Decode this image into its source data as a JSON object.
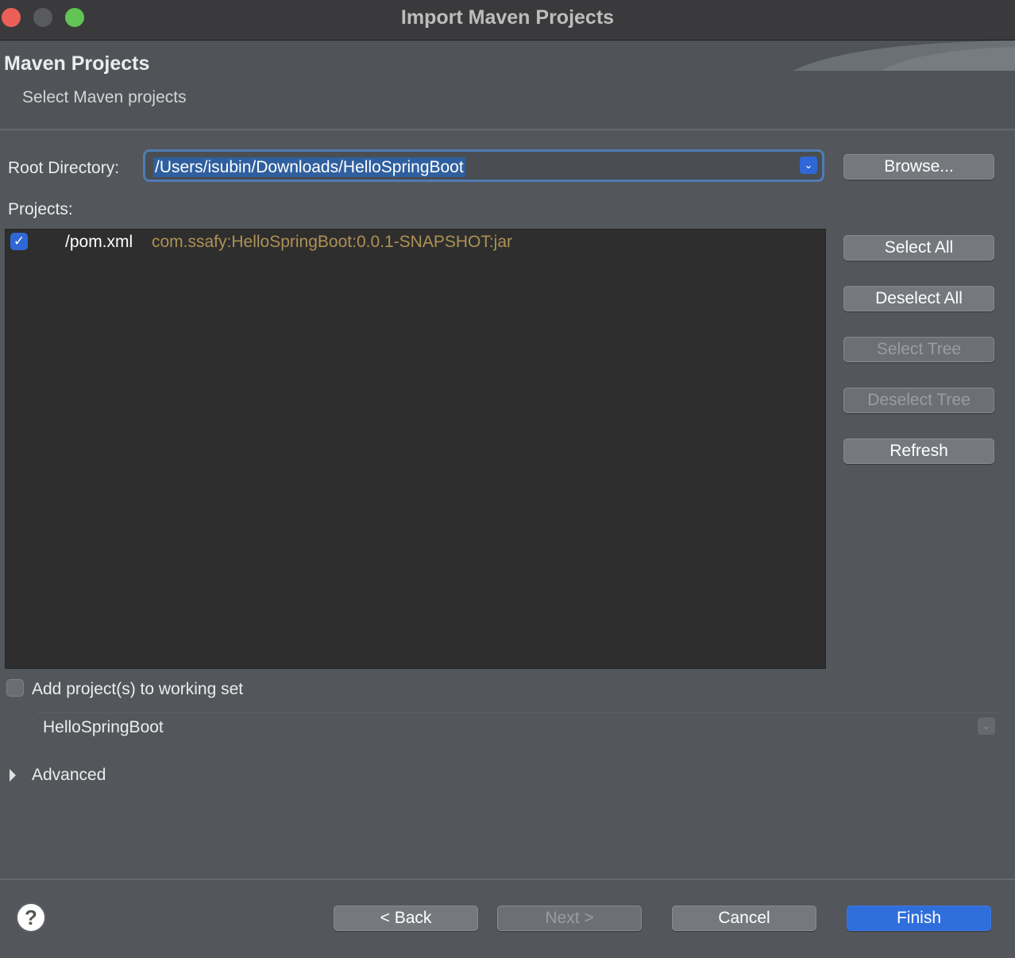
{
  "window": {
    "title": "Import Maven Projects"
  },
  "header": {
    "title": "Maven Projects",
    "subtitle": "Select Maven projects"
  },
  "root_directory": {
    "label": "Root Directory:",
    "value": "/Users/isubin/Downloads/HelloSpringBoot",
    "browse_label": "Browse..."
  },
  "projects": {
    "label": "Projects:",
    "items": [
      {
        "path": "/pom.xml",
        "id": "com.ssafy:HelloSpringBoot:0.0.1-SNAPSHOT:jar",
        "checked": true
      }
    ]
  },
  "side_buttons": {
    "select_all": "Select All",
    "deselect_all": "Deselect All",
    "select_tree": "Select Tree",
    "deselect_tree": "Deselect Tree",
    "refresh": "Refresh"
  },
  "working_set": {
    "checkbox_label": "Add project(s) to working set",
    "checked": false,
    "value": "HelloSpringBoot"
  },
  "advanced": {
    "label": "Advanced",
    "expanded": false
  },
  "footer": {
    "help_glyph": "?",
    "back": "< Back",
    "next": "Next >",
    "cancel": "Cancel",
    "finish": "Finish"
  },
  "colors": {
    "accent": "#2f6edb",
    "artifact_id_text": "#ad9154",
    "dialog_background": "#53575b",
    "list_background": "#2e2e2e"
  }
}
